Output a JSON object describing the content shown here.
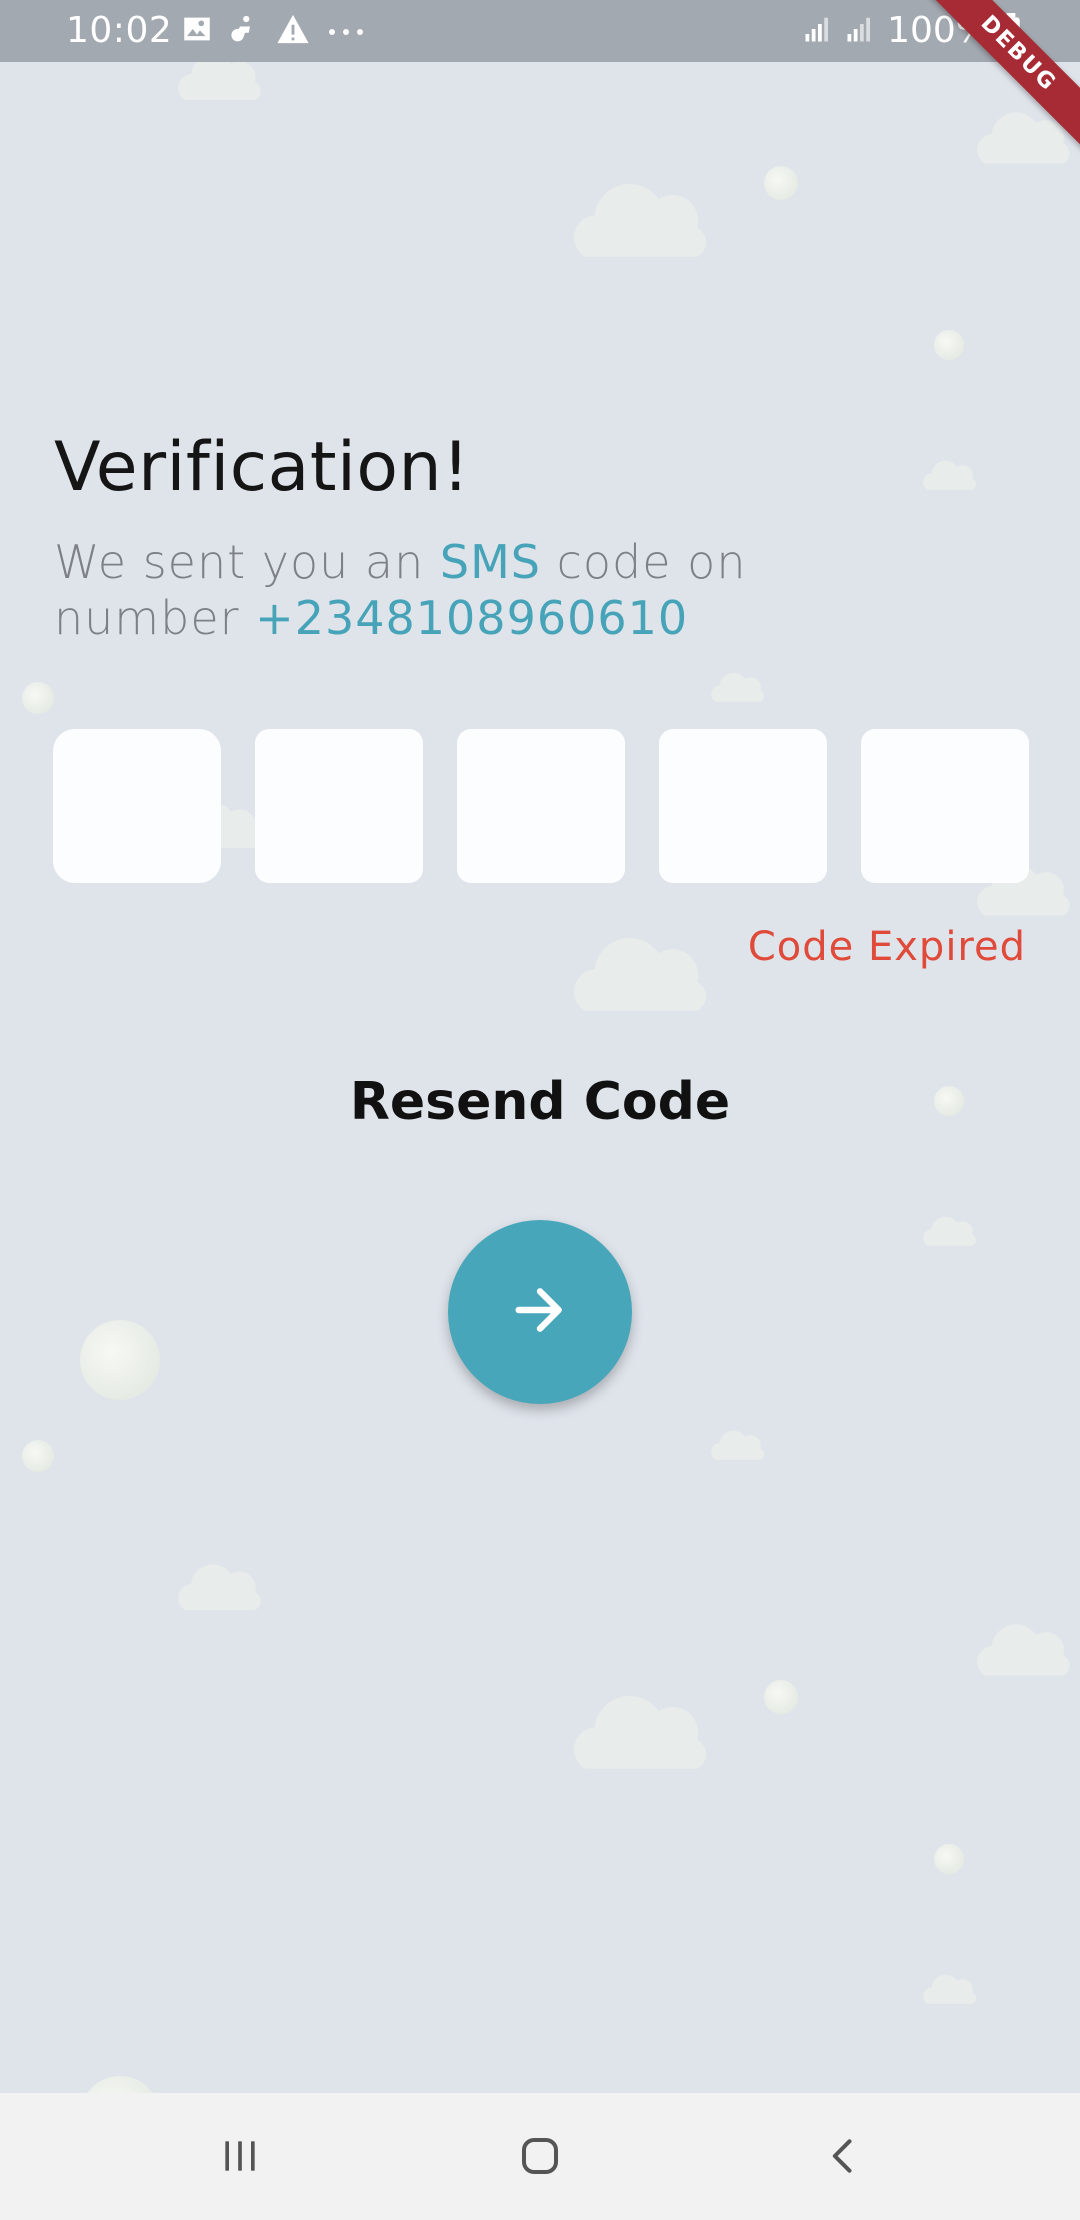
{
  "status_bar": {
    "time": "10:02",
    "battery": "100%",
    "left_icons": [
      "image-icon",
      "accessibility-icon",
      "warning-icon",
      "more-icon"
    ],
    "right_icons": [
      "signal-icon",
      "signal-icon",
      "battery-icon"
    ]
  },
  "debug_banner": "DEBUG",
  "verification": {
    "title": "Verification!",
    "line1_prefix": "We sent you an ",
    "line1_accent": "SMS",
    "line1_suffix": " code on",
    "line2_prefix": "number ",
    "phone": "+2348108960610"
  },
  "otp": {
    "boxes": [
      "",
      "",
      "",
      "",
      ""
    ]
  },
  "error_text": "Code Expired",
  "resend_label": "Resend Code",
  "next_button_icon": "arrow-right-icon",
  "nav_bar": {
    "recents_icon": "recents-icon",
    "home_icon": "home-icon",
    "back_icon": "back-icon"
  },
  "colors": {
    "background": "#dfe4eb",
    "accent": "#46a3b8",
    "error": "#e04a3a",
    "status_bar": "#a3a9b0",
    "debug_ribbon": "#a62b35"
  }
}
